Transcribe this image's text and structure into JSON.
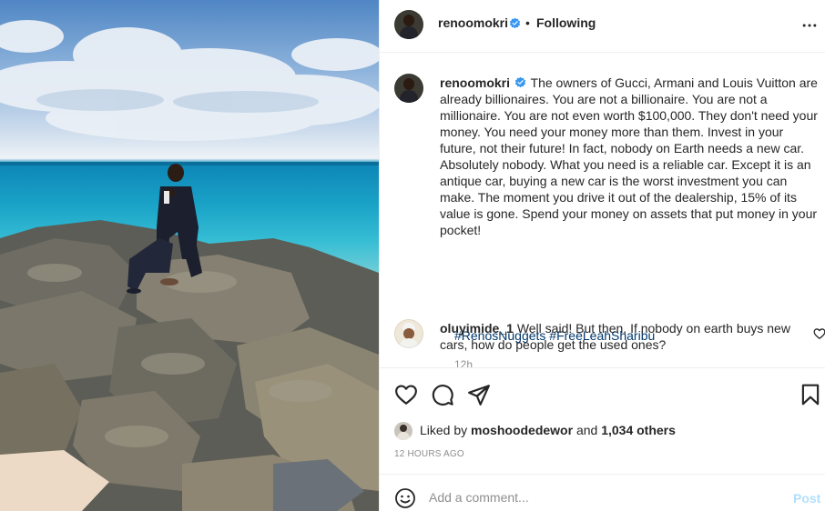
{
  "header": {
    "username": "renoomokri",
    "separator": "•",
    "follow_status": "Following",
    "more_icon": "more-horizontal-icon"
  },
  "post": {
    "username": "renoomokri",
    "caption": "The owners of Gucci, Armani and Louis Vuitton are already billionaires. You are not a billionaire. You are not a millionaire. You are not even worth $100,000. They don't need your money. You need your money more than them. Invest in your future, not their future! In fact, nobody on Earth needs a new car. Absolutely nobody. What you need is a reliable car. Except it is an antique car, buying a new car is the worst investment you can make. The moment you drive it out of the dealership, 15% of its value is gone. Spend your money on assets that put money in your pocket!",
    "hashtags": [
      "#RenosNuggets",
      "#FreeLeahSharibu"
    ],
    "time_ago": "12h",
    "verified_badge": "verified-badge-icon"
  },
  "comments": [
    {
      "username": "oluyimide_1",
      "text": "Well said! But then, If nobody on earth buys new cars, how do people get the used ones?"
    }
  ],
  "actions": {
    "icons": [
      "heart-icon",
      "comment-icon",
      "share-icon",
      "bookmark-icon"
    ]
  },
  "likes": {
    "prefix": "Liked by",
    "user": "moshoodedewor",
    "and": "and",
    "others": "1,034 others"
  },
  "post_time": "12 HOURS AGO",
  "add_comment": {
    "placeholder": "Add a comment...",
    "post_label": "Post",
    "emoji_icon": "emoji-icon"
  },
  "colors": {
    "verified": "#3897f0",
    "hashtag": "#00376b",
    "muted": "#8e8e8e",
    "post_disabled": "#b2dffc"
  }
}
